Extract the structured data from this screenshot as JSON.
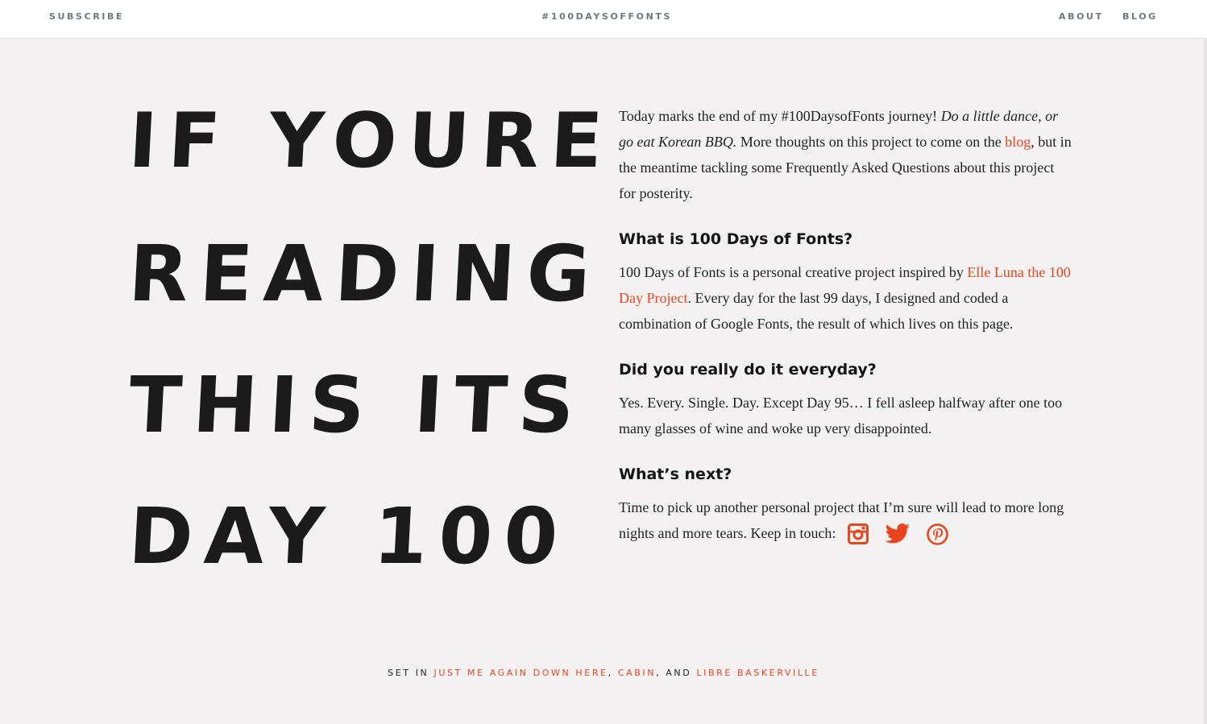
{
  "nav": {
    "subscribe": "SUBSCRIBE",
    "title": "#100DAYSOFFONTS",
    "about": "ABOUT",
    "blog": "BLOG"
  },
  "hero": {
    "line1": "IF YOURE",
    "line2": "READING",
    "line3": "THIS ITS",
    "line4": "DAY 100"
  },
  "intro": {
    "text1": "Today marks the end of my #100DaysofFonts journey! ",
    "italic": "Do a little dance, or go eat Korean BBQ.",
    "text2": " More thoughts on this project to come on the ",
    "blog_link": "blog",
    "text3": ", but in the meantime tackling some Frequently Asked Questions about this project for posterity."
  },
  "faq": [
    {
      "question": "What is 100 Days of Fonts?",
      "text1": "100 Days of Fonts is a personal creative project inspired by ",
      "link": "Elle Luna the 100 Day Project",
      "text2": ". Every day for the last 99 days, I designed and coded a combination of Google Fonts, the result of which lives on this page."
    },
    {
      "question": "Did you really do it everyday?",
      "text": "Yes. Every. Single. Day. Except Day 95… I fell asleep halfway after one too many glasses of wine and woke up very disappointed."
    },
    {
      "question": "What’s next?",
      "text": "Time to pick up another personal project that I’m sure will lead to more long nights and more tears. Keep in touch:"
    }
  ],
  "social": {
    "icons": [
      "instagram-icon",
      "twitter-icon",
      "pinterest-icon"
    ],
    "color": "#e8451e"
  },
  "footer": {
    "prefix": "SET IN ",
    "font1": "JUST ME AGAIN DOWN HERE",
    "sep1": ", ",
    "font2": "CABIN",
    "sep2": ", AND ",
    "font3": "LIBRE BASKERVILLE"
  },
  "colors": {
    "accent": "#e8451e",
    "background": "#f3f1f2",
    "nav_text": "#6f7780"
  }
}
